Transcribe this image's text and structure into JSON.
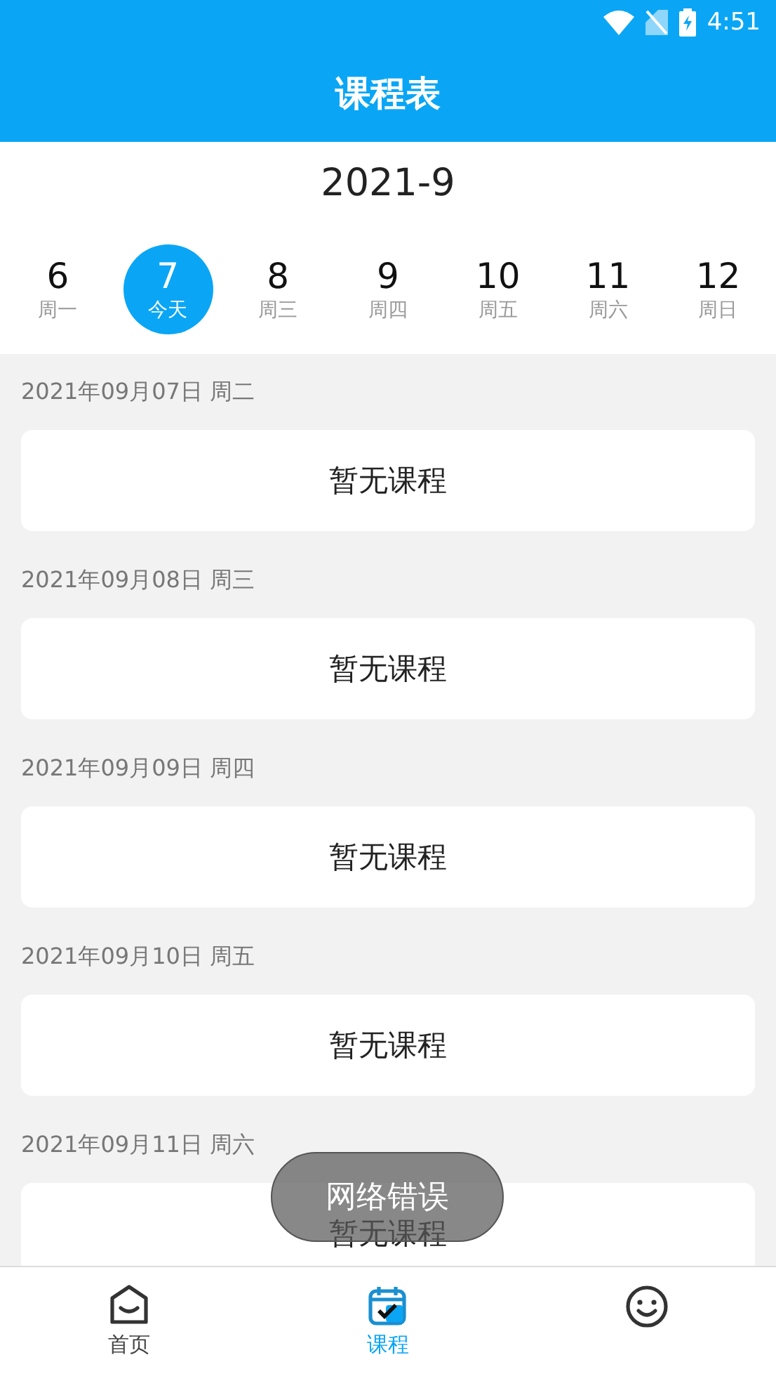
{
  "status_bar": {
    "time": "4:51"
  },
  "header": {
    "title": "课程表"
  },
  "month": "2021-9",
  "days": [
    {
      "date": "6",
      "weekday": "周一",
      "selected": false
    },
    {
      "date": "7",
      "weekday": "今天",
      "selected": true
    },
    {
      "date": "8",
      "weekday": "周三",
      "selected": false
    },
    {
      "date": "9",
      "weekday": "周四",
      "selected": false
    },
    {
      "date": "10",
      "weekday": "周五",
      "selected": false
    },
    {
      "date": "11",
      "weekday": "周六",
      "selected": false
    },
    {
      "date": "12",
      "weekday": "周日",
      "selected": false
    }
  ],
  "sections": [
    {
      "date": "2021年09月07日 周二",
      "message": "暂无课程"
    },
    {
      "date": "2021年09月08日 周三",
      "message": "暂无课程"
    },
    {
      "date": "2021年09月09日 周四",
      "message": "暂无课程"
    },
    {
      "date": "2021年09月10日 周五",
      "message": "暂无课程"
    },
    {
      "date": "2021年09月11日 周六",
      "message": "暂无课程"
    }
  ],
  "toast": "网络错误",
  "nav": [
    {
      "label": "首页",
      "selected": false
    },
    {
      "label": "课程",
      "selected": true
    },
    {
      "selected": false
    }
  ]
}
